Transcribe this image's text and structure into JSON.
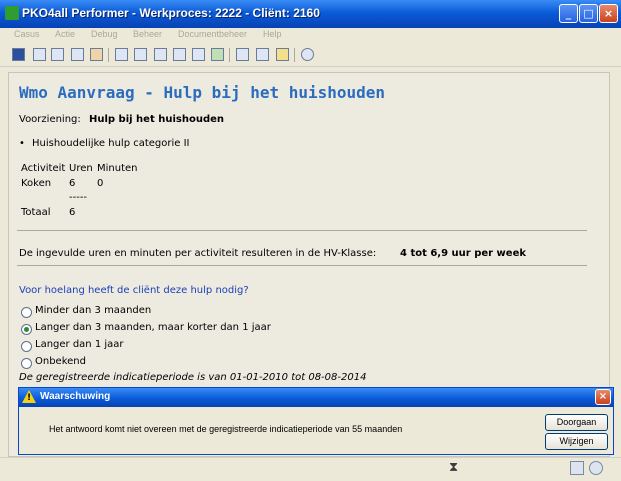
{
  "window": {
    "title": "PKO4all Performer - Werkproces: 2222 - Cliënt: 2160",
    "icon": "tree-icon",
    "controls": {
      "minimize": "_",
      "maximize": "□",
      "close": "×"
    }
  },
  "menu": [
    "Casus",
    "Actie",
    "Debug",
    "Beheer",
    "Documentbeheer",
    "Help"
  ],
  "toolbar_icons": [
    "save-icon",
    "first-icon",
    "previous-icon",
    "next-icon",
    "edit-icon",
    "sort-icon",
    "tree-expand-icon",
    "list-icon",
    "document-icon",
    "refresh-icon",
    "form-icon",
    "window-icon",
    "export-icon",
    "settings-icon"
  ],
  "document": {
    "title": "Wmo Aanvraag - Hulp bij het huishouden",
    "voorziening_label": "Voorziening:",
    "voorziening_value": "Hulp bij het huishouden",
    "bullet": "•",
    "category": "Huishoudelijke hulp categorie II",
    "table": {
      "headers": [
        "Activiteit",
        "Uren",
        "Minuten"
      ],
      "rows": [
        {
          "activity": "Koken",
          "hours": "6",
          "minutes": "0"
        }
      ],
      "separator": "-----",
      "total_label": "Totaal",
      "total_value": "6"
    },
    "result_text": "De ingevulde uren en minuten per activiteit resulteren in de HV-Klasse:",
    "result_value": "4 tot 6,9 uur per week",
    "question": "Voor hoelang heeft de cliënt deze hulp nodig?",
    "options": [
      {
        "label": "Minder dan 3 maanden",
        "selected": false
      },
      {
        "label": "Langer dan 3 maanden, maar korter dan 1 jaar",
        "selected": true
      },
      {
        "label": "Langer dan 1 jaar",
        "selected": false
      },
      {
        "label": "Onbekend",
        "selected": false
      }
    ],
    "period_note": "De geregistreerde indicatieperiode is van 01-01-2010 tot 08-08-2014"
  },
  "dialog": {
    "title": "Waarschuwing",
    "icon": "warning-icon",
    "icon_glyph": "!",
    "close": "×",
    "message": "Het antwoord komt niet overeen met de geregistreerde indicatieperiode van 55 maanden",
    "buttons": {
      "continue": "Doorgaan",
      "change": "Wijzigen"
    }
  },
  "statusbar": {
    "hourglass": "⧗",
    "icons": [
      "chart-icon",
      "gear-icon"
    ]
  },
  "colors": {
    "title_blue": "#2c6cbf",
    "question_blue": "#1b3fb8",
    "titlebar": "#0a5bd8"
  }
}
